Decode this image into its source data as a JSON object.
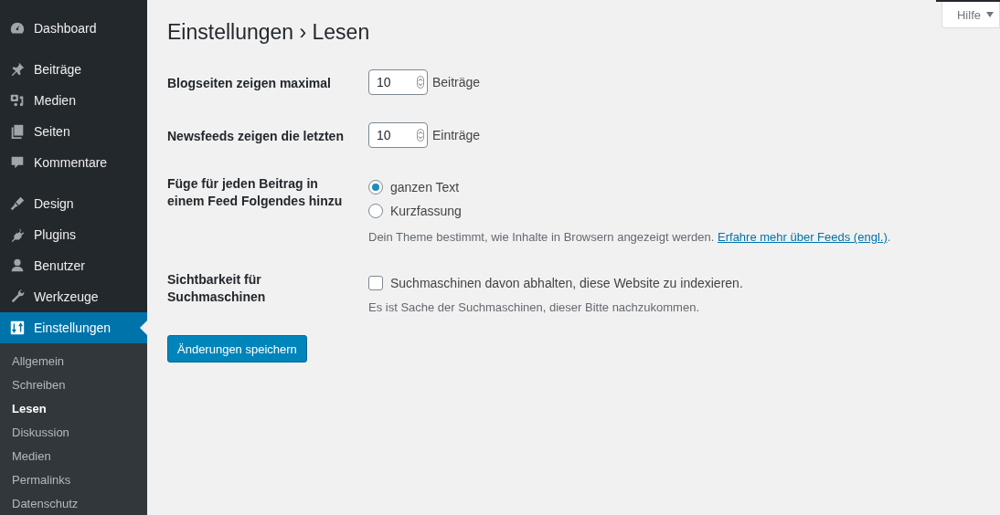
{
  "sidebar": {
    "groups": [
      {
        "items": [
          {
            "label": "Dashboard",
            "selected": false
          }
        ]
      },
      {
        "items": [
          {
            "label": "Beiträge",
            "selected": false
          },
          {
            "label": "Medien",
            "selected": false
          },
          {
            "label": "Seiten",
            "selected": false
          },
          {
            "label": "Kommentare",
            "selected": false
          }
        ]
      },
      {
        "items": [
          {
            "label": "Design",
            "selected": false
          },
          {
            "label": "Plugins",
            "selected": false
          },
          {
            "label": "Benutzer",
            "selected": false
          },
          {
            "label": "Werkzeuge",
            "selected": false
          },
          {
            "label": "Einstellungen",
            "selected": true
          }
        ]
      }
    ],
    "submenu": [
      {
        "label": "Allgemein",
        "selected": false
      },
      {
        "label": "Schreiben",
        "selected": false
      },
      {
        "label": "Lesen",
        "selected": true
      },
      {
        "label": "Diskussion",
        "selected": false
      },
      {
        "label": "Medien",
        "selected": false
      },
      {
        "label": "Permalinks",
        "selected": false
      },
      {
        "label": "Datenschutz",
        "selected": false
      }
    ]
  },
  "help_tab": {
    "label": "Hilfe"
  },
  "page_title": "Einstellungen › Lesen",
  "settings": [
    {
      "kind": "number",
      "label": "Blogseiten zeigen maximal",
      "value": "10",
      "unit": "Beiträge"
    },
    {
      "kind": "number",
      "label": "Newsfeeds zeigen die letzten",
      "value": "10",
      "unit": "Einträge"
    },
    {
      "kind": "radio",
      "label": "Füge für jeden Beitrag in einem Feed Folgendes hinzu",
      "options": [
        {
          "label": "ganzen Text",
          "selected": true
        },
        {
          "label": "Kurzfassung",
          "selected": false
        }
      ],
      "description": "Dein Theme bestimmt, wie Inhalte in Browsern angezeigt werden.",
      "link": "Erfahre mehr über Feeds (engl.)",
      "after_link": "."
    },
    {
      "kind": "checkbox",
      "label": "Sichtbarkeit für Suchmaschinen",
      "option": "Suchmaschinen davon abhalten, diese Website zu indexieren.",
      "checked": false,
      "description": "Es ist Sache der Suchmaschinen, dieser Bitte nachzukommen."
    }
  ],
  "save_button": "Änderungen speichern"
}
